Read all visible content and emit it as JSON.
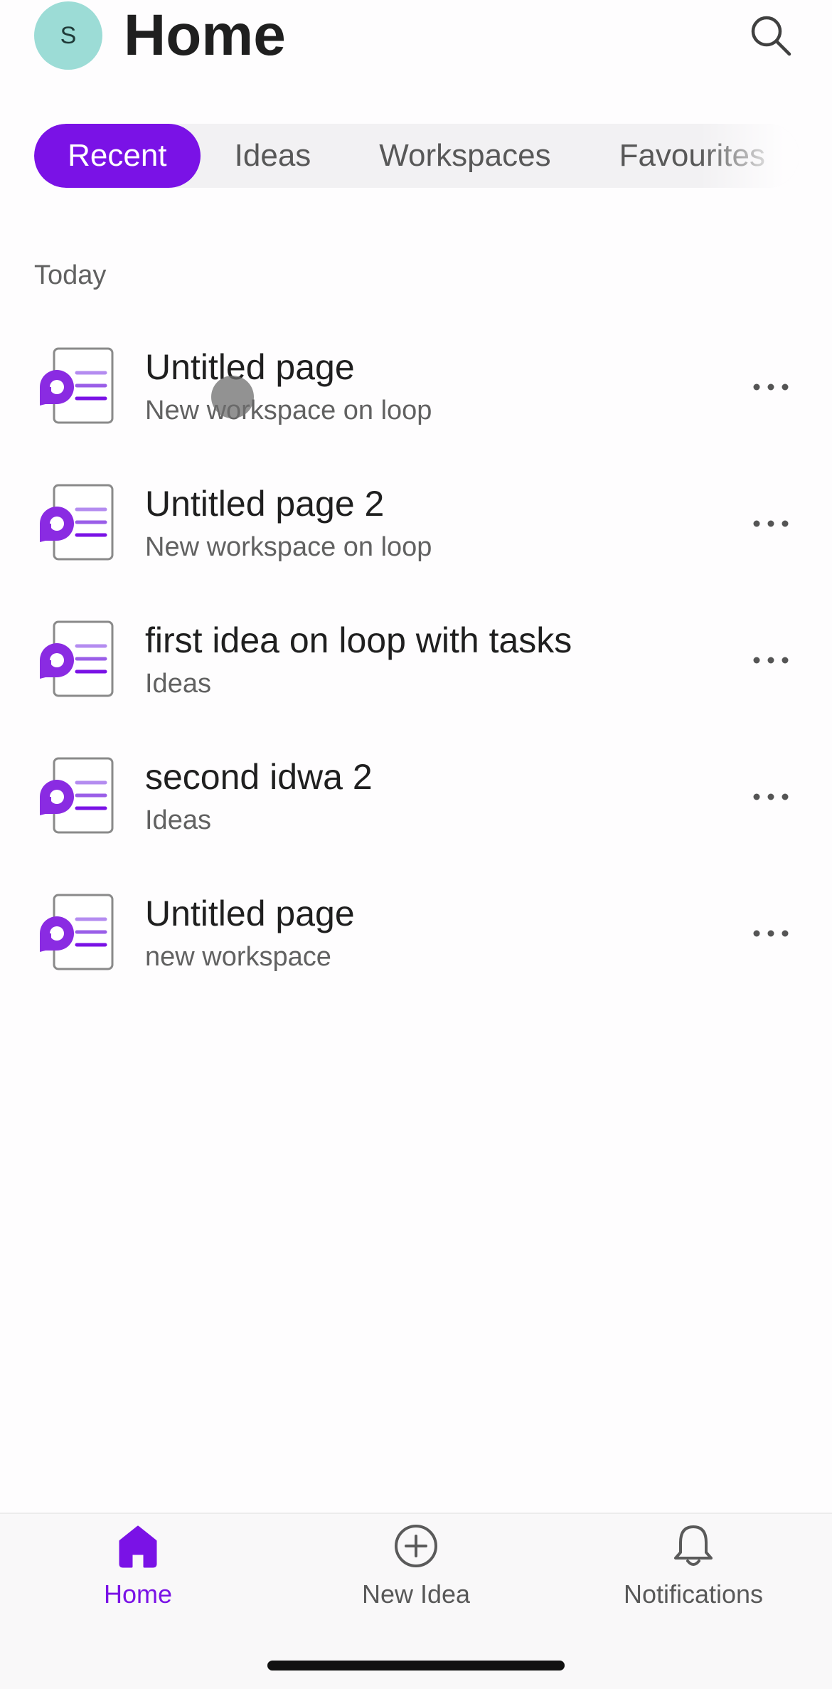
{
  "header": {
    "avatar_initial": "S",
    "title": "Home",
    "search_icon": "search-icon"
  },
  "tabs": [
    {
      "label": "Recent",
      "active": true
    },
    {
      "label": "Ideas",
      "active": false
    },
    {
      "label": "Workspaces",
      "active": false
    },
    {
      "label": "Favourites",
      "active": false
    }
  ],
  "section": {
    "label": "Today"
  },
  "items": [
    {
      "title": "Untitled page",
      "subtitle": "New workspace on loop",
      "icon": "loop-page-icon"
    },
    {
      "title": "Untitled page 2",
      "subtitle": "New workspace on loop",
      "icon": "loop-page-icon"
    },
    {
      "title": "first idea on loop with tasks",
      "subtitle": "Ideas",
      "icon": "loop-page-icon"
    },
    {
      "title": "second idwa 2",
      "subtitle": "Ideas",
      "icon": "loop-page-icon"
    },
    {
      "title": "Untitled page",
      "subtitle": "new workspace",
      "icon": "loop-page-icon"
    }
  ],
  "bottom_nav": [
    {
      "label": "Home",
      "icon": "home-icon",
      "active": true
    },
    {
      "label": "New Idea",
      "icon": "add-circle-icon",
      "active": false
    },
    {
      "label": "Notifications",
      "icon": "bell-icon",
      "active": false
    }
  ],
  "colors": {
    "accent": "#7a12e6",
    "avatar_bg": "#9cdcd6",
    "tab_bg": "#f2f1f3"
  }
}
